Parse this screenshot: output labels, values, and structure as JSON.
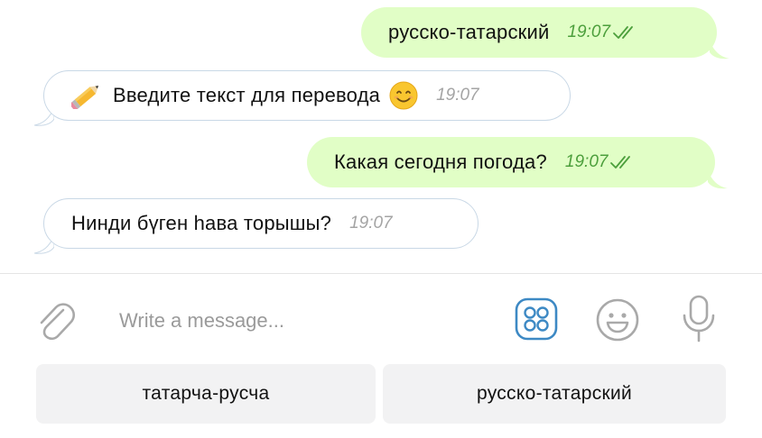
{
  "messages": [
    {
      "direction": "outgoing",
      "text": "русско-татарский",
      "time": "19:07",
      "read": true
    },
    {
      "direction": "incoming",
      "text": "Введите текст для перевода",
      "time": "19:07",
      "leading_emoji": "pencil-icon",
      "trailing_emoji": "smiling-face-icon"
    },
    {
      "direction": "outgoing",
      "text": "Какая сегодня погода?",
      "time": "19:07",
      "read": true
    },
    {
      "direction": "incoming",
      "text": "Нинди бүген һава торышы?",
      "time": "19:07"
    }
  ],
  "composer": {
    "placeholder": "Write a message...",
    "icons": [
      "attach-icon",
      "bot-commands-icon",
      "emoji-icon",
      "microphone-icon"
    ]
  },
  "keyboard": {
    "buttons": [
      {
        "label": "татарча-русча"
      },
      {
        "label": "русско-татарский"
      }
    ]
  },
  "colors": {
    "outgoing_bubble": "#e1fec6",
    "incoming_border": "#c9d8e6",
    "outgoing_time": "#4c9f3c",
    "incoming_time": "#a4a4a4",
    "accent": "#3d89c4",
    "keyboard_button": "#f2f2f3"
  }
}
